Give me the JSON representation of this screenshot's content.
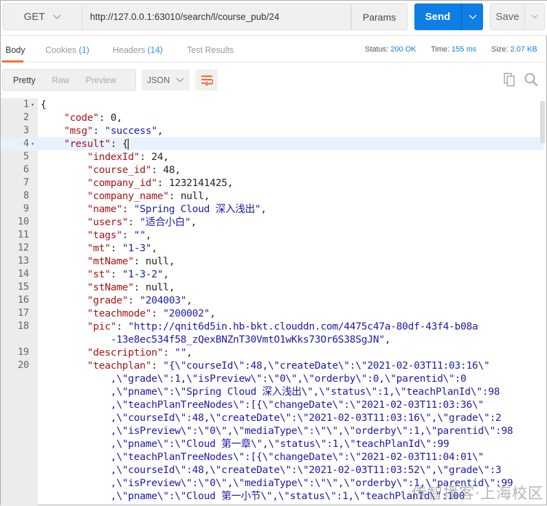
{
  "request": {
    "method": "GET",
    "url": "http://127.0.0.1:63010/search/l/course_pub/24",
    "params_label": "Params",
    "send_label": "Send",
    "save_label": "Save"
  },
  "response_tabs": [
    {
      "label": "Body",
      "count": ""
    },
    {
      "label": "Cookies",
      "count": "(1)"
    },
    {
      "label": "Headers",
      "count": "(14)"
    },
    {
      "label": "Test Results",
      "count": ""
    }
  ],
  "status": {
    "status_label": "Status:",
    "status_value": "200 OK",
    "time_label": "Time:",
    "time_value": "155 ms",
    "size_label": "Size:",
    "size_value": "2.07 KB"
  },
  "view_modes": [
    "Pretty",
    "Raw",
    "Preview"
  ],
  "format": "JSON",
  "icons": [
    "chevron-down-icon",
    "wrap-lines-icon",
    "copy-icon",
    "search-icon",
    "fold-arrow-icon"
  ],
  "colors": {
    "accent": "#f26b2a",
    "send": "#0e7ee6",
    "key": "#a31515",
    "string": "#1a1aa6"
  },
  "watermark": "传智播客·上海校区",
  "code_lines": [
    {
      "num": "1",
      "fold": true,
      "parts": [
        [
          "p",
          "{"
        ]
      ]
    },
    {
      "num": "2",
      "parts": [
        [
          "p",
          "    "
        ],
        [
          "k",
          "\"code\""
        ],
        [
          "p",
          ": "
        ],
        [
          "n",
          "0"
        ],
        [
          "p",
          ","
        ]
      ]
    },
    {
      "num": "3",
      "parts": [
        [
          "p",
          "    "
        ],
        [
          "k",
          "\"msg\""
        ],
        [
          "p",
          ": "
        ],
        [
          "s",
          "\"success\""
        ],
        [
          "p",
          ","
        ]
      ]
    },
    {
      "num": "4",
      "fold": true,
      "hl": true,
      "cursor": true,
      "parts": [
        [
          "p",
          "    "
        ],
        [
          "k",
          "\"result\""
        ],
        [
          "p",
          ": {"
        ]
      ]
    },
    {
      "num": "5",
      "parts": [
        [
          "p",
          "        "
        ],
        [
          "k",
          "\"indexId\""
        ],
        [
          "p",
          ": "
        ],
        [
          "n",
          "24"
        ],
        [
          "p",
          ","
        ]
      ]
    },
    {
      "num": "6",
      "parts": [
        [
          "p",
          "        "
        ],
        [
          "k",
          "\"course_id\""
        ],
        [
          "p",
          ": "
        ],
        [
          "n",
          "48"
        ],
        [
          "p",
          ","
        ]
      ]
    },
    {
      "num": "7",
      "parts": [
        [
          "p",
          "        "
        ],
        [
          "k",
          "\"company_id\""
        ],
        [
          "p",
          ": "
        ],
        [
          "n",
          "1232141425"
        ],
        [
          "p",
          ","
        ]
      ]
    },
    {
      "num": "8",
      "parts": [
        [
          "p",
          "        "
        ],
        [
          "k",
          "\"company_name\""
        ],
        [
          "p",
          ": "
        ],
        [
          "n",
          "null"
        ],
        [
          "p",
          ","
        ]
      ]
    },
    {
      "num": "9",
      "parts": [
        [
          "p",
          "        "
        ],
        [
          "k",
          "\"name\""
        ],
        [
          "p",
          ": "
        ],
        [
          "s",
          "\"Spring Cloud 深入浅出\""
        ],
        [
          "p",
          ","
        ]
      ]
    },
    {
      "num": "10",
      "parts": [
        [
          "p",
          "        "
        ],
        [
          "k",
          "\"users\""
        ],
        [
          "p",
          ": "
        ],
        [
          "s",
          "\"适合小白\""
        ],
        [
          "p",
          ","
        ]
      ]
    },
    {
      "num": "11",
      "parts": [
        [
          "p",
          "        "
        ],
        [
          "k",
          "\"tags\""
        ],
        [
          "p",
          ": "
        ],
        [
          "s",
          "\"\""
        ],
        [
          "p",
          ","
        ]
      ]
    },
    {
      "num": "12",
      "parts": [
        [
          "p",
          "        "
        ],
        [
          "k",
          "\"mt\""
        ],
        [
          "p",
          ": "
        ],
        [
          "s",
          "\"1-3\""
        ],
        [
          "p",
          ","
        ]
      ]
    },
    {
      "num": "13",
      "parts": [
        [
          "p",
          "        "
        ],
        [
          "k",
          "\"mtName\""
        ],
        [
          "p",
          ": "
        ],
        [
          "n",
          "null"
        ],
        [
          "p",
          ","
        ]
      ]
    },
    {
      "num": "14",
      "parts": [
        [
          "p",
          "        "
        ],
        [
          "k",
          "\"st\""
        ],
        [
          "p",
          ": "
        ],
        [
          "s",
          "\"1-3-2\""
        ],
        [
          "p",
          ","
        ]
      ]
    },
    {
      "num": "15",
      "parts": [
        [
          "p",
          "        "
        ],
        [
          "k",
          "\"stName\""
        ],
        [
          "p",
          ": "
        ],
        [
          "n",
          "null"
        ],
        [
          "p",
          ","
        ]
      ]
    },
    {
      "num": "16",
      "parts": [
        [
          "p",
          "        "
        ],
        [
          "k",
          "\"grade\""
        ],
        [
          "p",
          ": "
        ],
        [
          "s",
          "\"204003\""
        ],
        [
          "p",
          ","
        ]
      ]
    },
    {
      "num": "17",
      "parts": [
        [
          "p",
          "        "
        ],
        [
          "k",
          "\"teachmode\""
        ],
        [
          "p",
          ": "
        ],
        [
          "s",
          "\"200002\""
        ],
        [
          "p",
          ","
        ]
      ]
    },
    {
      "num": "18",
      "parts": [
        [
          "p",
          "        "
        ],
        [
          "k",
          "\"pic\""
        ],
        [
          "p",
          ": "
        ],
        [
          "s",
          "\"http://qnit6d5in.hb-bkt.clouddn.com/4475c47a-80df-43f4-b08a"
        ]
      ]
    },
    {
      "num": "",
      "parts": [
        [
          "p",
          "            "
        ],
        [
          "s",
          "-13e8ec534f58_zQexBNZnT30VmtO1wKks73Or6S38SgJN\""
        ],
        [
          "p",
          ","
        ]
      ]
    },
    {
      "num": "19",
      "parts": [
        [
          "p",
          "        "
        ],
        [
          "k",
          "\"description\""
        ],
        [
          "p",
          ": "
        ],
        [
          "s",
          "\"\""
        ],
        [
          "p",
          ","
        ]
      ]
    },
    {
      "num": "20",
      "parts": [
        [
          "p",
          "        "
        ],
        [
          "k",
          "\"teachplan\""
        ],
        [
          "p",
          ": "
        ],
        [
          "s",
          "\"{\\\"courseId\\\":48,\\\"createDate\\\":\\\"2021-02-03T11:03:16\\\""
        ]
      ]
    },
    {
      "num": "",
      "parts": [
        [
          "p",
          "            "
        ],
        [
          "s",
          ",\\\"grade\\\":1,\\\"isPreview\\\":\\\"0\\\",\\\"orderby\\\":0,\\\"parentid\\\":0"
        ]
      ]
    },
    {
      "num": "",
      "parts": [
        [
          "p",
          "            "
        ],
        [
          "s",
          ",\\\"pname\\\":\\\"Spring Cloud 深入浅出\\\",\\\"status\\\":1,\\\"teachPlanId\\\":98"
        ]
      ]
    },
    {
      "num": "",
      "parts": [
        [
          "p",
          "            "
        ],
        [
          "s",
          ",\\\"teachPlanTreeNodes\\\":[{\\\"changeDate\\\":\\\"2021-02-03T11:03:36\\\""
        ]
      ]
    },
    {
      "num": "",
      "parts": [
        [
          "p",
          "            "
        ],
        [
          "s",
          ",\\\"courseId\\\":48,\\\"createDate\\\":\\\"2021-02-03T11:03:16\\\",\\\"grade\\\":2"
        ]
      ]
    },
    {
      "num": "",
      "parts": [
        [
          "p",
          "            "
        ],
        [
          "s",
          ",\\\"isPreview\\\":\\\"0\\\",\\\"mediaType\\\":\\\"\\\",\\\"orderby\\\":1,\\\"parentid\\\":98"
        ]
      ]
    },
    {
      "num": "",
      "parts": [
        [
          "p",
          "            "
        ],
        [
          "s",
          ",\\\"pname\\\":\\\"Cloud 第一章\\\",\\\"status\\\":1,\\\"teachPlanId\\\":99"
        ]
      ]
    },
    {
      "num": "",
      "parts": [
        [
          "p",
          "            "
        ],
        [
          "s",
          ",\\\"teachPlanTreeNodes\\\":[{\\\"changeDate\\\":\\\"2021-02-03T11:04:01\\\""
        ]
      ]
    },
    {
      "num": "",
      "parts": [
        [
          "p",
          "            "
        ],
        [
          "s",
          ",\\\"courseId\\\":48,\\\"createDate\\\":\\\"2021-02-03T11:03:52\\\",\\\"grade\\\":3"
        ]
      ]
    },
    {
      "num": "",
      "parts": [
        [
          "p",
          "            "
        ],
        [
          "s",
          ",\\\"isPreview\\\":\\\"0\\\",\\\"mediaType\\\":\\\"\\\",\\\"orderby\\\":1,\\\"parentid\\\":99"
        ]
      ]
    },
    {
      "num": "",
      "parts": [
        [
          "p",
          "            "
        ],
        [
          "s",
          ",\\\"pname\\\":\\\"Cloud 第一小节\\\",\\\"status\\\":1,\\\"teachPlanId\\\":100"
        ]
      ]
    }
  ]
}
